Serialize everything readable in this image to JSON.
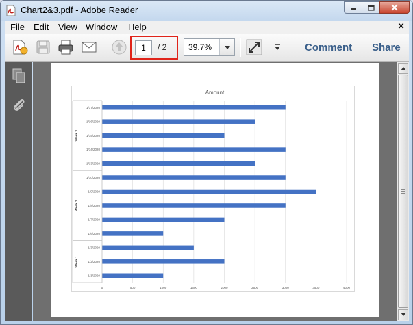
{
  "window": {
    "title": "Chart2&3.pdf - Adobe Reader"
  },
  "menu": {
    "items": [
      "File",
      "Edit",
      "View",
      "Window",
      "Help"
    ],
    "close_glyph": "×"
  },
  "toolbar": {
    "icons": [
      "create-pdf-icon",
      "save-icon",
      "print-icon",
      "email-icon",
      "previous-page-icon"
    ],
    "page_current": "1",
    "page_total": "/ 2",
    "zoom": "39.7%",
    "comment_label": "Comment",
    "share_label": "Share"
  },
  "sidebar": {
    "icons": [
      "pages-icon",
      "attachments-icon"
    ]
  },
  "colors": {
    "bar": "#4472c4",
    "grid": "#d9d9d9",
    "highlight": "#e0241a"
  },
  "chart_data": {
    "type": "bar",
    "orientation": "horizontal",
    "title": "Amount",
    "categories": [
      "1/17/2020",
      "1/16/2020",
      "1/15/2020",
      "1/14/2020",
      "1/13/2020",
      "1/10/2020",
      "1/9/2020",
      "1/8/2020",
      "1/7/2020",
      "1/6/2020",
      "1/3/2020",
      "1/2/2020",
      "1/1/2020"
    ],
    "values": [
      3000,
      2500,
      2000,
      3000,
      2500,
      3000,
      3500,
      3000,
      2000,
      1000,
      1500,
      2000,
      1000
    ],
    "groups": [
      {
        "name": "Week 3",
        "count": 5
      },
      {
        "name": "Week 2",
        "count": 5
      },
      {
        "name": "Week 1",
        "count": 3
      }
    ],
    "xticks": [
      "0",
      "500",
      "1000",
      "1500",
      "2000",
      "2500",
      "3000",
      "3500",
      "4000"
    ],
    "xlim": [
      0,
      4000
    ],
    "grid": true,
    "legend": "none"
  }
}
